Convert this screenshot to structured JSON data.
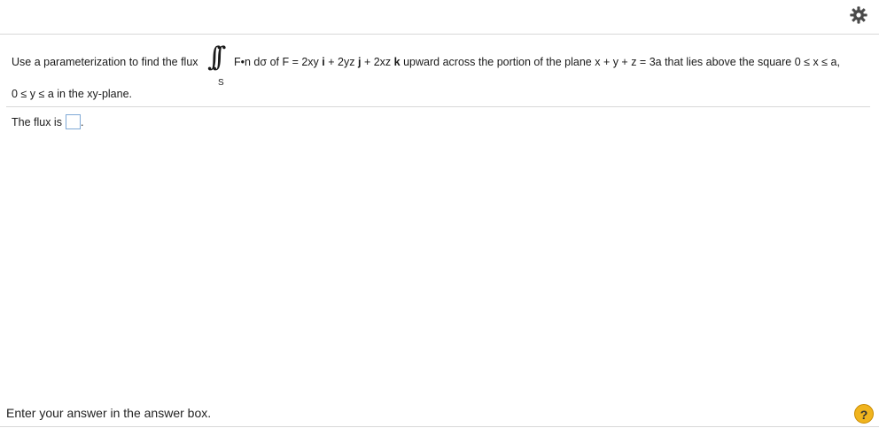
{
  "toolbar": {
    "settings_icon": "gear-icon"
  },
  "question": {
    "intro": "Use a parameterization to find the flux",
    "integral_subscript": "S",
    "integrand": "F•n dσ of F = 2xy",
    "i": "i",
    "plus1": "+ 2yz",
    "j": "j",
    "plus2": "+ 2xz",
    "k": "k",
    "rest": "upward across the portion of the plane x + y + z = 3a that lies above the square 0 ≤ x ≤ a,",
    "line2": "0 ≤ y ≤ a in the xy-plane."
  },
  "answer": {
    "label": "The flux is",
    "suffix": ".",
    "value": ""
  },
  "footer": {
    "instruction": "Enter your answer in the answer box.",
    "help_label": "?"
  },
  "colors": {
    "help_bg": "#f0b41e",
    "answer_border": "#7fa9d6"
  }
}
